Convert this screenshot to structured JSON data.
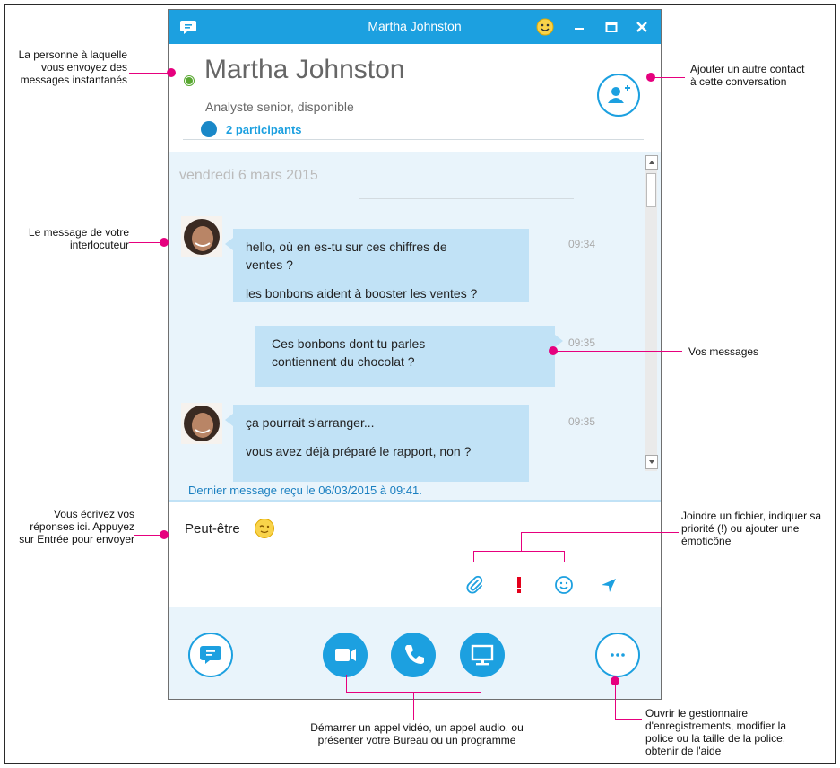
{
  "window": {
    "title": "Martha Johnston"
  },
  "contact": {
    "name": "Martha Johnston",
    "subtitle": "Analyste senior, disponible",
    "participants": "2 participants",
    "status_color": "#59a832"
  },
  "conversation": {
    "date": "vendredi 6 mars 2015",
    "messages": [
      {
        "direction": "incoming",
        "lines": [
          "hello, où en es-tu sur ces chiffres de ventes ?",
          "les bonbons aident à booster les ventes ?"
        ],
        "time": "09:34"
      },
      {
        "direction": "outgoing",
        "lines": [
          "Ces bonbons dont tu parles contiennent du chocolat ?"
        ],
        "time": "09:35"
      },
      {
        "direction": "incoming",
        "lines": [
          "ça pourrait s'arranger...",
          "vous avez déjà préparé le rapport, non ?"
        ],
        "time": "09:35"
      }
    ],
    "last_message": "Dernier message reçu le 06/03/2015 à 09:41."
  },
  "compose": {
    "text": "Peut-être",
    "icons": [
      "paperclip-icon",
      "priority-icon",
      "emoticon-icon",
      "send-icon"
    ]
  },
  "toolbar": {
    "buttons": [
      "im-icon",
      "video-icon",
      "phone-icon",
      "screen-share-icon",
      "more-icon"
    ]
  },
  "annotations": {
    "person": "La personne à laquelle vous envoyez des messages instantanés",
    "add_contact": "Ajouter un autre contact à cette conversation",
    "their_message": "Le message de votre interlocuteur",
    "your_messages": "Vos messages",
    "write_here": "Vous écrivez vos réponses ici. Appuyez sur Entrée pour envoyer",
    "attach": "Joindre un fichier, indiquer sa priorité (!) ou ajouter une émoticône",
    "calls": "Démarrer un appel vidéo, un appel audio, ou présenter votre Bureau ou un programme",
    "more": "Ouvrir le gestionnaire d'enregistrements, modifier la police ou la taille de la police, obtenir de l'aide"
  },
  "colors": {
    "accent": "#1ca0e0",
    "annotation": "#e6007e",
    "bubble": "#c1e2f6",
    "chat_bg": "#e9f4fb"
  }
}
